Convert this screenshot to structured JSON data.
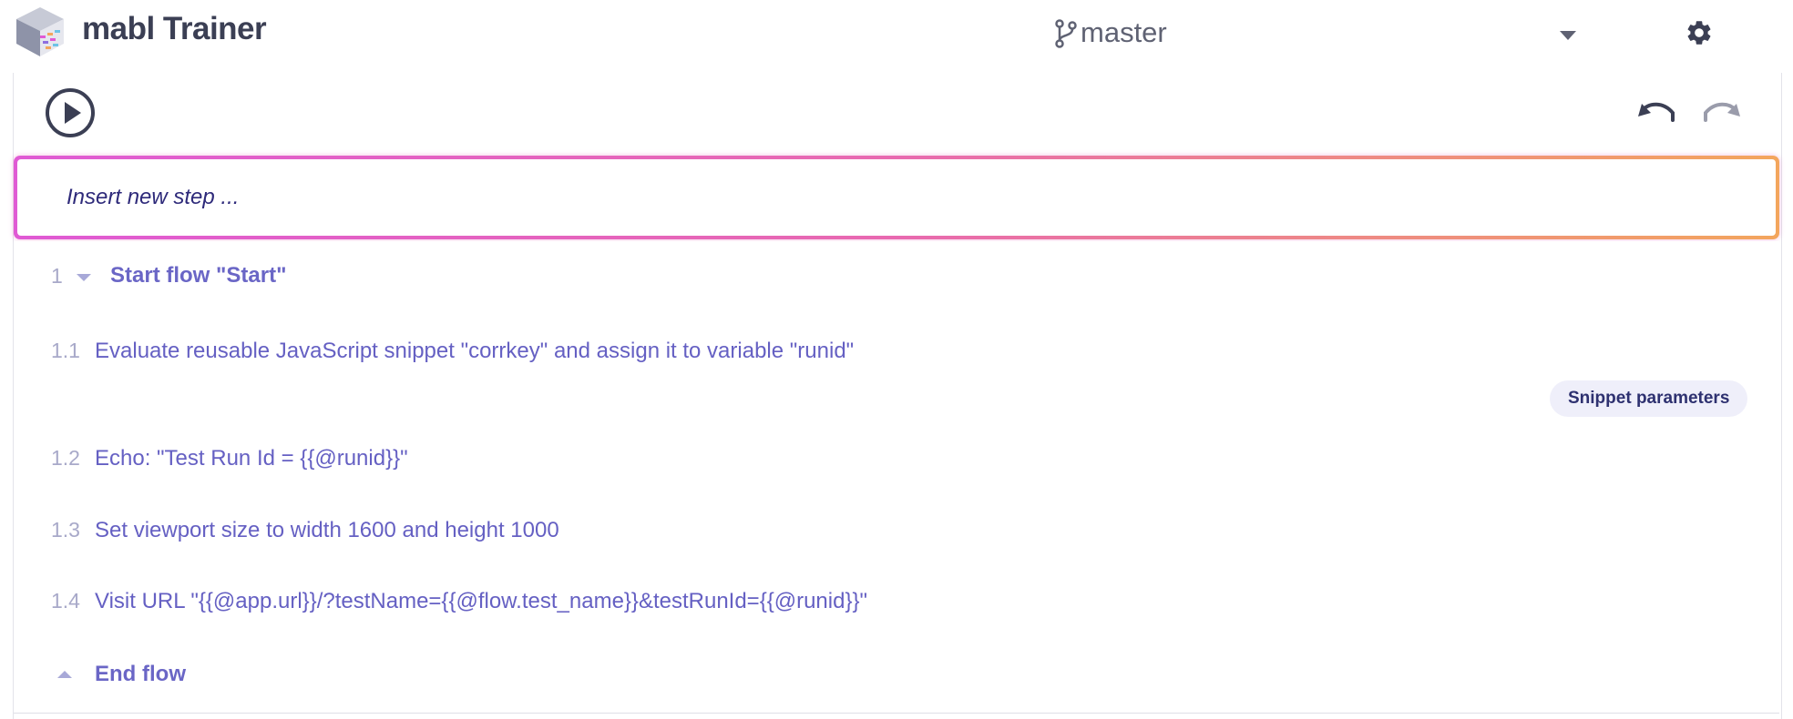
{
  "header": {
    "app_name": "mabl Trainer",
    "branch": "master"
  },
  "icons": {
    "logo": "mabl-cube-logo",
    "branch": "git-branch-icon",
    "dropdown": "chevron-down-icon",
    "settings": "gear-icon",
    "play": "play-circle-icon",
    "undo": "undo-icon",
    "redo": "redo-icon"
  },
  "insert": {
    "placeholder": "Insert new step ..."
  },
  "steps": [
    {
      "num": "1",
      "text": "Start flow \"Start\""
    },
    {
      "num": "1.1",
      "text": "Evaluate reusable JavaScript snippet \"corrkey\" and assign it to variable \"runid\"",
      "action": "Snippet parameters"
    },
    {
      "num": "1.2",
      "text": "Echo: \"Test Run Id = {{@runid}}\""
    },
    {
      "num": "1.3",
      "text": "Set viewport size to width 1600 and height 1000"
    },
    {
      "num": "1.4",
      "text": "Visit URL \"{{@app.url}}/?testName={{@flow.test_name}}&testRunId={{@runid}}\""
    },
    {
      "num": "",
      "text": "End flow"
    }
  ],
  "colors": {
    "accent": "#6560c3",
    "insert_gradient_start": "#e05ad4",
    "insert_gradient_end": "#f3a65d"
  }
}
